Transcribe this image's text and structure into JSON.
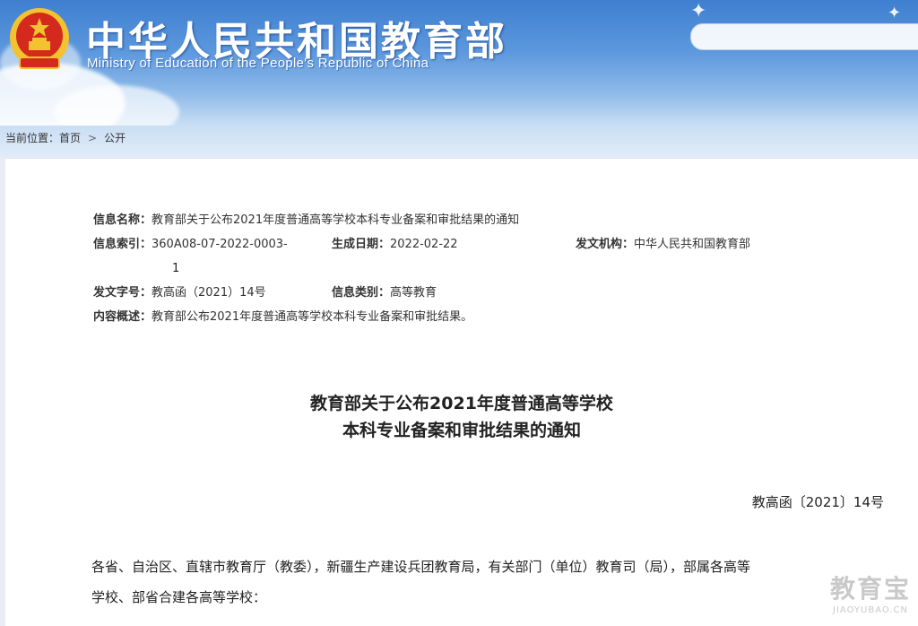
{
  "header": {
    "title": "中华人民共和国教育部",
    "subtitle": "Ministry of Education of the People's Republic of China"
  },
  "breadcrumb": {
    "label": "当前位置：",
    "home": "首页",
    "separator": ">",
    "current": "公开"
  },
  "meta": {
    "name_label": "信息名称：",
    "name_value": "教育部关于公布2021年度普通高等学校本科专业备案和审批结果的通知",
    "index_label": "信息索引：",
    "index_value_line1": "360A08-07-2022-0003-",
    "index_value_line2": "1",
    "date_label": "生成日期：",
    "date_value": "2022-02-22",
    "issuer_label": "发文机构：",
    "issuer_value": "中华人民共和国教育部",
    "docno_label": "发文字号：",
    "docno_value": "教高函（2021）14号",
    "category_label": "信息类别：",
    "category_value": "高等教育",
    "summary_label": "内容概述：",
    "summary_value": "教育部公布2021年度普通高等学校本科专业备案和审批结果。"
  },
  "document": {
    "title_line1": "教育部关于公布2021年度普通高等学校",
    "title_line2": "本科专业备案和审批结果的通知",
    "number": "教高函〔2021〕14号",
    "body_line1": "各省、自治区、直辖市教育厅（教委），新疆生产建设兵团教育局，有关部门（单位）教育司（局），部属各高等",
    "body_line2": "学校、部省合建各高等学校："
  },
  "watermark": {
    "cn": "教育宝",
    "en": "JIAOYUBAO.CN"
  },
  "colors": {
    "header_blue": "#3f7fd0",
    "emblem_red": "#d42a1e",
    "emblem_gold": "#f2c230"
  }
}
